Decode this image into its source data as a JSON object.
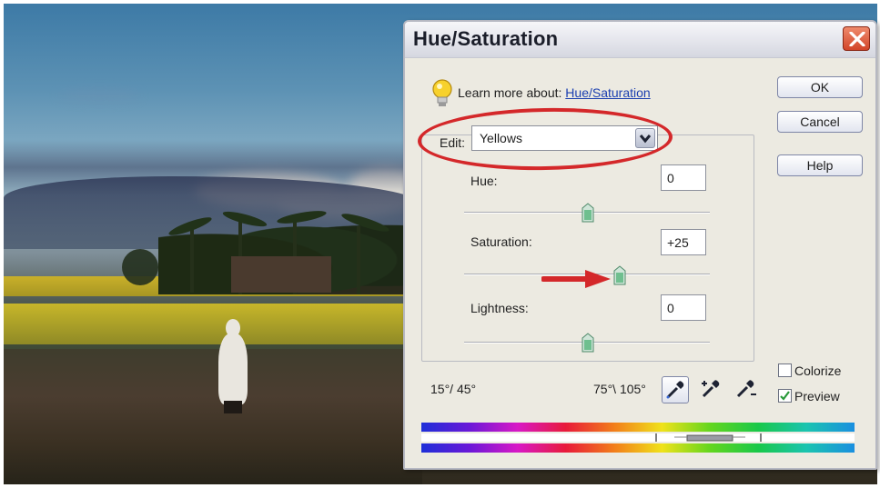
{
  "dialog": {
    "title": "Hue/Saturation",
    "learn_prefix": "Learn more about:",
    "learn_link": "Hue/Saturation",
    "buttons": {
      "ok": "OK",
      "cancel": "Cancel",
      "help": "Help"
    },
    "edit": {
      "label": "Edit:",
      "value": "Yellows"
    },
    "hue": {
      "label": "Hue:",
      "value": "0"
    },
    "saturation": {
      "label": "Saturation:",
      "value": "+25"
    },
    "lightness": {
      "label": "Lightness:",
      "value": "0"
    },
    "range_left": "15°/ 45°",
    "range_right": "75°\\ 105°",
    "colorize": {
      "label": "Colorize",
      "checked": false
    },
    "preview": {
      "label": "Preview",
      "checked": true
    }
  },
  "colors": {
    "highlight_ellipse": "#d4282a",
    "close_button": "#d2452a",
    "link": "#1b3fb0"
  },
  "icons": [
    "lightbulb-icon",
    "close-icon",
    "chevron-down-icon",
    "eyedropper-icon",
    "eyedropper-plus-icon",
    "eyedropper-minus-icon",
    "checkmark-icon",
    "red-arrow-annotation"
  ]
}
